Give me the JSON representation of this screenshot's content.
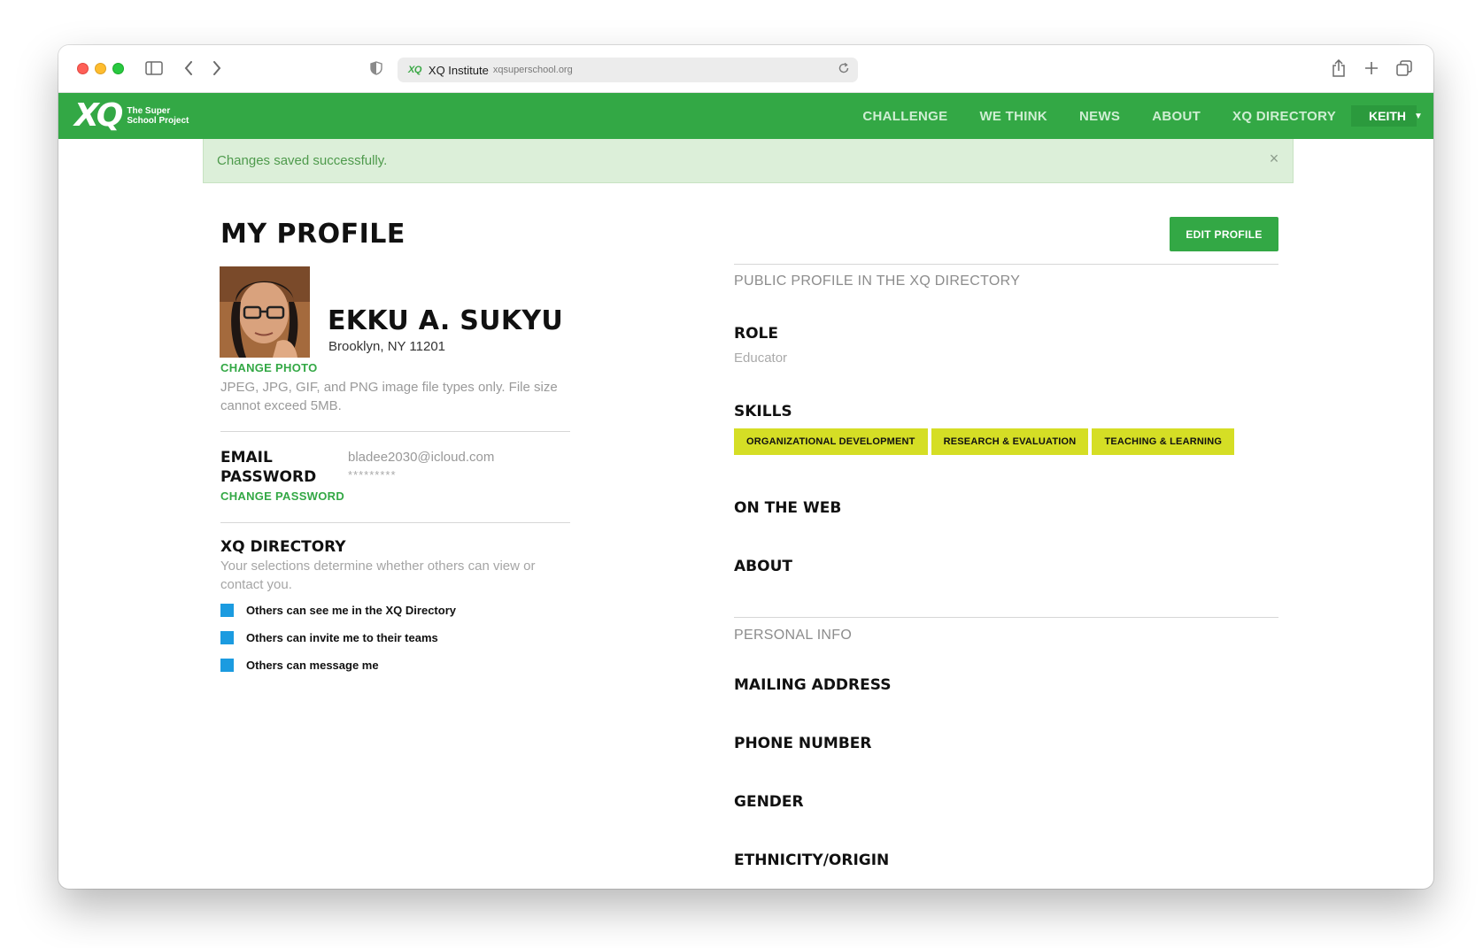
{
  "browser": {
    "tab_title": "XQ Institute",
    "domain": "xqsuperschool.org",
    "url_logo": "XQ"
  },
  "site": {
    "logo": "XQ",
    "logo_text": "The Super School Project",
    "brand_color": "#33a845",
    "nav": [
      "CHALLENGE",
      "WE THINK",
      "NEWS",
      "ABOUT",
      "XQ DIRECTORY"
    ],
    "user_menu": "KEITH"
  },
  "alert": {
    "message": "Changes saved successfully.",
    "close": "×"
  },
  "profile": {
    "title": "MY PROFILE",
    "name": "EKKU A. SUKYU",
    "location": "Brooklyn, NY 11201",
    "change_photo": "CHANGE PHOTO",
    "photo_help": "JPEG, JPG, GIF, and PNG image file types only. File size cannot exceed 5MB.",
    "email_label": "EMAIL",
    "email": "bladee2030@icloud.com",
    "password_label": "PASSWORD",
    "password": "*********",
    "change_password": "CHANGE PASSWORD",
    "directory_label": "XQ DIRECTORY",
    "directory_help": "Your selections determine whether others can view or contact you.",
    "options": [
      "Others can see me in the XQ Directory",
      "Others can invite me to their teams",
      "Others can message me"
    ],
    "checkbox_color": "#1b9be0"
  },
  "public": {
    "edit_button": "EDIT PROFILE",
    "heading": "PUBLIC PROFILE IN THE XQ DIRECTORY",
    "role_label": "ROLE",
    "role": "Educator",
    "skills_label": "SKILLS",
    "skills": [
      "ORGANIZATIONAL DEVELOPMENT",
      "RESEARCH & EVALUATION",
      "TEACHING & LEARNING"
    ],
    "skill_color": "#d5de25",
    "web_label": "ON THE WEB",
    "about_label": "ABOUT"
  },
  "personal": {
    "heading": "PERSONAL INFO",
    "mailing_label": "MAILING ADDRESS",
    "phone_label": "PHONE NUMBER",
    "gender_label": "GENDER",
    "ethnicity_label": "ETHNICITY/ORIGIN"
  }
}
